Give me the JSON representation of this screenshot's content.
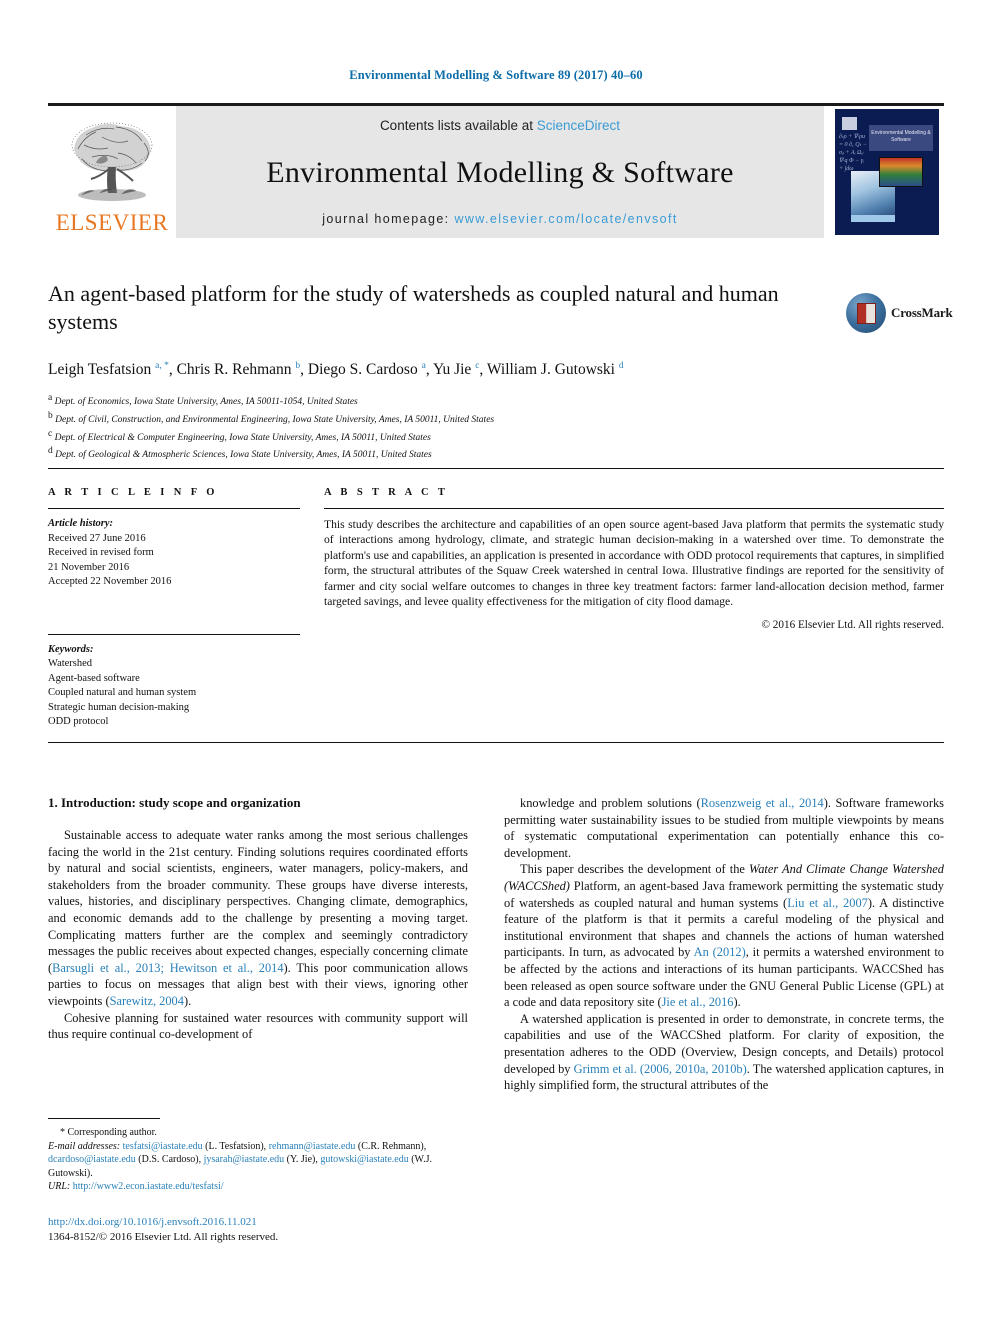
{
  "running_head": "Environmental Modelling & Software 89 (2017) 40–60",
  "masthead": {
    "publisher_logo_label": "ELSEVIER",
    "contents_prefix": "Contents lists available at ",
    "contents_link": "ScienceDirect",
    "journal_name": "Environmental Modelling & Software",
    "homepage_prefix": "journal homepage: ",
    "homepage_link": "www.elsevier.com/locate/envsoft",
    "cover_title": "Environmental Modelling & Software",
    "cover_formula": "∂ₜρ + ∇·ρu = 0 ∂ₓ Qₜ − σᵢⱼ + Aᵢ Ωᵢⱼ ∇·q Φ − γᵢ + ∫dω"
  },
  "crossmark": {
    "label": "CrossMark"
  },
  "title": "An agent-based platform for the study of watersheds as coupled natural and human systems",
  "authors_html": "Leigh Tesfatsion <sup class=\"sup\">a, *</sup>, Chris R. Rehmann <sup class=\"sup\">b</sup>, Diego S. Cardoso <sup class=\"sup\">a</sup>, Yu Jie <sup class=\"sup\">c</sup>, William J. Gutowski <sup class=\"sup\">d</sup>",
  "affiliations": [
    {
      "mark": "a",
      "text": "Dept. of Economics, Iowa State University, Ames, IA 50011-1054, United States"
    },
    {
      "mark": "b",
      "text": "Dept. of Civil, Construction, and Environmental Engineering, Iowa State University, Ames, IA 50011, United States"
    },
    {
      "mark": "c",
      "text": "Dept. of Electrical & Computer Engineering, Iowa State University, Ames, IA 50011, United States"
    },
    {
      "mark": "d",
      "text": "Dept. of Geological & Atmospheric Sciences, Iowa State University, Ames, IA 50011, United States"
    }
  ],
  "article_info": {
    "heading": "A R T I C L E  I N F O",
    "history_label": "Article history:",
    "history_lines": [
      "Received 27 June 2016",
      "Received in revised form",
      "21 November 2016",
      "Accepted 22 November 2016"
    ],
    "keywords_label": "Keywords:",
    "keywords": [
      "Watershed",
      "Agent-based software",
      "Coupled natural and human system",
      "Strategic human decision-making",
      "ODD protocol"
    ]
  },
  "abstract": {
    "heading": "A B S T R A C T",
    "text": "This study describes the architecture and capabilities of an open source agent-based Java platform that permits the systematic study of interactions among hydrology, climate, and strategic human decision-making in a watershed over time. To demonstrate the platform's use and capabilities, an application is presented in accordance with ODD protocol requirements that captures, in simplified form, the structural attributes of the Squaw Creek watershed in central Iowa. Illustrative findings are reported for the sensitivity of farmer and city social welfare outcomes to changes in three key treatment factors: farmer land-allocation decision method, farmer targeted savings, and levee quality effectiveness for the mitigation of city flood damage.",
    "copyright": "© 2016 Elsevier Ltd. All rights reserved."
  },
  "body": {
    "section_heading": "1. Introduction: study scope and organization",
    "left_paragraphs_html": [
      "Sustainable access to adequate water ranks among the most serious challenges facing the world in the 21st century. Finding solutions requires coordinated efforts by natural and social scientists, engineers, water managers, policy-makers, and stakeholders from the broader community. These groups have diverse interests, values, histories, and disciplinary perspectives. Changing climate, demographics, and economic demands add to the challenge by presenting a moving target. Complicating matters further are the complex and seemingly contradictory messages the public receives about expected changes, especially concerning climate (<span class=\"cite\">Barsugli et al., 2013; Hewitson et al., 2014</span>). This poor communication allows parties to focus on messages that align best with their views, ignoring other viewpoints (<span class=\"cite\">Sarewitz, 2004</span>).",
      "Cohesive planning for sustained water resources with community support will thus require continual co-development of"
    ],
    "right_paragraphs_html": [
      "knowledge and problem solutions (<span class=\"cite\">Rosenzweig et al., 2014</span>). Software frameworks permitting water sustainability issues to be studied from multiple viewpoints by means of systematic computational experimentation can potentially enhance this co-development.",
      "This paper describes the development of the <span class=\"ital\">Water And Climate Change Watershed (WACCShed)</span> Platform, an agent-based Java framework permitting the systematic study of watersheds as coupled natural and human systems (<span class=\"cite\">Liu et al., 2007</span>). A distinctive feature of the platform is that it permits a careful modeling of the physical and institutional environment that shapes and channels the actions of human watershed participants. In turn, as advocated by <span class=\"cite\">An (2012)</span>, it permits a watershed environment to be affected by the actions and interactions of its human participants. WACCShed has been released as open source software under the GNU General Public License (GPL) at a code and data repository site (<span class=\"cite\">Jie et al., 2016</span>).",
      "A watershed application is presented in order to demonstrate, in concrete terms, the capabilities and use of the WACCShed platform. For clarity of exposition, the presentation adheres to the ODD (Overview, Design concepts, and Details) protocol developed by <span class=\"cite\">Grimm et al. (2006, 2010a, 2010b)</span>. The watershed application captures, in highly simplified form, the structural attributes of the"
    ]
  },
  "footnotes": {
    "corresponding_author": "* Corresponding author.",
    "email_label": "E-mail addresses:",
    "emails_html": "<span class=\"lnk\">tesfatsi@iastate.edu</span> (L. Tesfatsion), <span class=\"lnk\">rehmann@iastate.edu</span> (C.R. Rehmann), <span class=\"lnk\">dcardoso@iastate.edu</span> (D.S. Cardoso), <span class=\"lnk\">jysarah@iastate.edu</span> (Y. Jie), <span class=\"lnk\">gutowski@iastate.edu</span> (W.J. Gutowski).",
    "url_label": "URL:",
    "url": "http://www2.econ.iastate.edu/tesfatsi/"
  },
  "doi_block": {
    "doi": "http://dx.doi.org/10.1016/j.envsoft.2016.11.021",
    "issn_line": "1364-8152/© 2016 Elsevier Ltd. All rights reserved."
  },
  "colors": {
    "link_blue": "#2980b9",
    "header_blue": "#0b6ca8",
    "sciencedirect_blue": "#3a9bd4",
    "elsevier_orange": "#E87722",
    "band_gray": "#e6e6e6"
  }
}
